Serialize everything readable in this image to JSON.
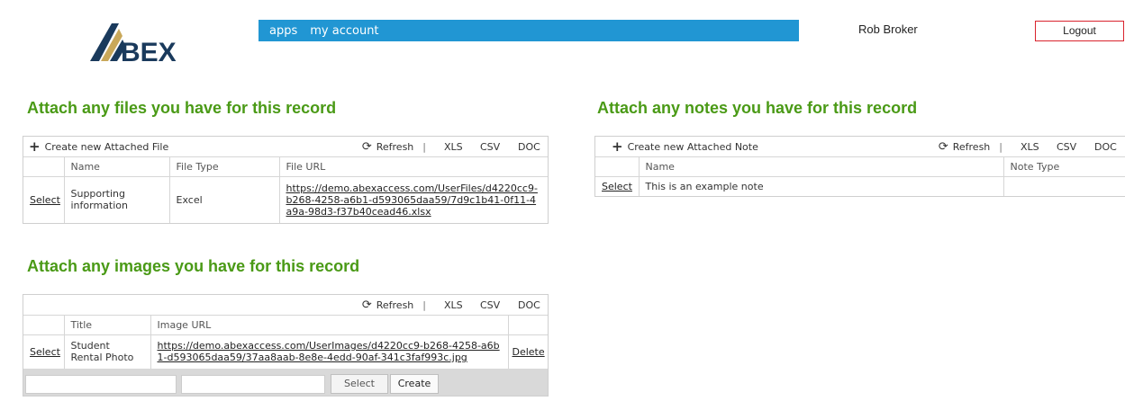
{
  "brand": {
    "logo_text": "BEX",
    "logo_accent": "#1a3a5c"
  },
  "nav": {
    "items": [
      "apps",
      "my account"
    ]
  },
  "user": {
    "name": "Rob Broker",
    "logout_label": "Logout"
  },
  "files": {
    "title": "Attach any files you have for this record",
    "create_label": "Create new Attached File",
    "refresh_label": "Refresh",
    "export": [
      "XLS",
      "CSV",
      "DOC"
    ],
    "columns": [
      "Name",
      "File Type",
      "File URL"
    ],
    "rows": [
      {
        "select": "Select",
        "name": "Supporting information",
        "type": "Excel",
        "url": "https://demo.abexaccess.com/UserFiles/d4220cc9-b268-4258-a6b1-d593065daa59/7d9c1b41-0f11-4a9a-98d3-f37b40cead46.xlsx"
      }
    ]
  },
  "images": {
    "title": "Attach any images you have for this record",
    "refresh_label": "Refresh",
    "export": [
      "XLS",
      "CSV",
      "DOC"
    ],
    "columns": [
      "Title",
      "Image URL"
    ],
    "rows": [
      {
        "select": "Select",
        "title": "Student Rental Photo",
        "url": "https://demo.abexaccess.com/UserImages/d4220cc9-b268-4258-a6b1-d593065daa59/37aa8aab-8e8e-4edd-90af-341c3faf993c.jpg",
        "delete": "Delete"
      }
    ],
    "footer": {
      "select_label": "Select",
      "create_label": "Create"
    }
  },
  "notes": {
    "title": "Attach any notes you have for this record",
    "create_label": "Create new Attached Note",
    "refresh_label": "Refresh",
    "export": [
      "XLS",
      "CSV",
      "DOC"
    ],
    "columns": [
      "Name",
      "Note Type"
    ],
    "rows": [
      {
        "select": "Select",
        "name": "This is an example note",
        "type": ""
      }
    ]
  },
  "colors": {
    "nav": "#2196d3",
    "title": "#4a9a16",
    "logout_border": "#d9232d"
  }
}
